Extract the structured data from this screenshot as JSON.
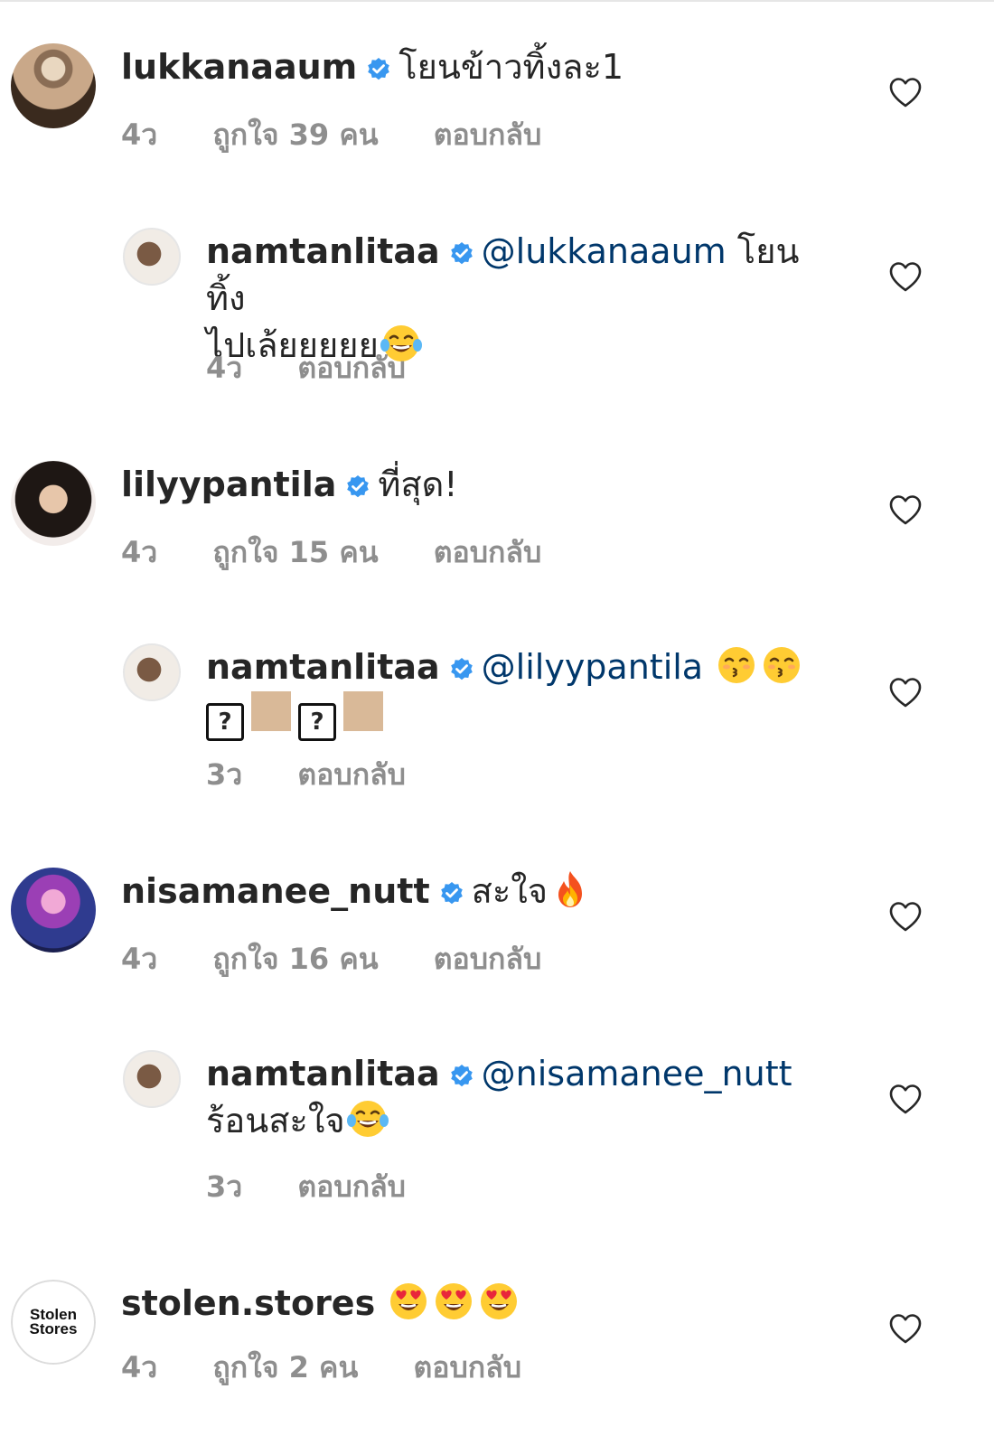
{
  "comments": [
    {
      "username": "lukkanaaum",
      "text": "โยนข้าวทิ้งละ1",
      "time": "4ว",
      "likes": "ถูกใจ 39 คน",
      "reply_label": "ตอบกลับ",
      "replies": [
        {
          "username": "namtanlitaa",
          "mention": "@lukkanaaum",
          "text": "โยนทิ้ง",
          "text2": "ไปเล้ยยยยย",
          "time": "4ว",
          "reply_label": "ตอบกลับ"
        }
      ]
    },
    {
      "username": "lilyypantila",
      "text": "ที่สุด!",
      "time": "4ว",
      "likes": "ถูกใจ 15 คน",
      "reply_label": "ตอบกลับ",
      "replies": [
        {
          "username": "namtanlitaa",
          "mention": "@lilyypantila",
          "box_glyph": "?",
          "time": "3ว",
          "reply_label": "ตอบกลับ"
        }
      ]
    },
    {
      "username": "nisamanee_nutt",
      "text": "สะใจ",
      "time": "4ว",
      "likes": "ถูกใจ 16 คน",
      "reply_label": "ตอบกลับ",
      "replies": [
        {
          "username": "namtanlitaa",
          "mention": "@nisamanee_nutt",
          "text2": "ร้อนสะใจ",
          "time": "3ว",
          "reply_label": "ตอบกลับ"
        }
      ]
    },
    {
      "username": "stolen.stores",
      "avatar_text": [
        "Stolen",
        "Stores"
      ],
      "time": "4ว",
      "likes": "ถูกใจ 2 คน",
      "reply_label": "ตอบกลับ"
    }
  ],
  "icons": {
    "verified": "verified-badge-icon",
    "like": "heart-outline-icon",
    "emojis": [
      "face-with-tears-of-joy",
      "kissing-face-smiling-eyes",
      "fire",
      "smiling-face-heart-eyes"
    ]
  },
  "colors": {
    "username": "#262626",
    "meta": "#8e8e8e",
    "mention": "#00376b",
    "verified": "#3897f0"
  }
}
